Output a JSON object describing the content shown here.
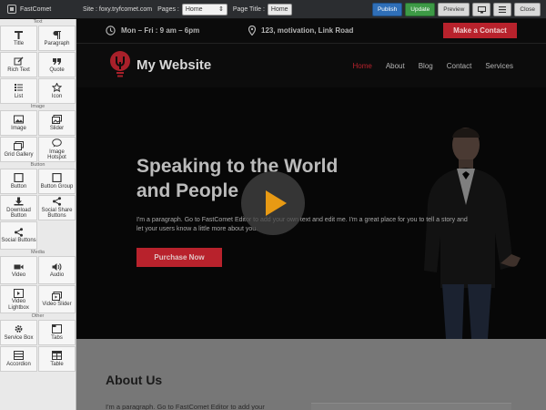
{
  "toolbar": {
    "brand": "FastComet",
    "site_label": "Site : foxy.tryfcomet.com",
    "pages_label": "Pages :",
    "pages_value": "Home",
    "page_title_label": "Page Title :",
    "page_title_value": "Home",
    "publish": "Publish",
    "update": "Update",
    "preview": "Preview",
    "close": "Close"
  },
  "sidebar": {
    "sections": {
      "text": "Text",
      "image": "Image",
      "button": "Button",
      "media": "Media",
      "other": "Other"
    },
    "widgets": {
      "title": "Title",
      "paragraph": "Paragraph",
      "rich_text": "Rich Text",
      "quote": "Quote",
      "list": "List",
      "icon": "Icon",
      "image": "Image",
      "slider": "Slider",
      "grid_gallery": "Grid Gallery",
      "image_hotspot": "Image Hotspot",
      "button": "Button",
      "button_group": "Button Group",
      "download_button": "Download Button",
      "social_share_buttons": "Social Share Buttons",
      "social_buttons": "Social Buttons",
      "video": "Video",
      "audio": "Audio",
      "video_lightbox": "Video Lightbox",
      "video_slider": "Video Slider",
      "service_box": "Service Box",
      "tabs": "Tabs",
      "accordion": "Accordion",
      "table": "Table"
    }
  },
  "site": {
    "hours": "Mon – Fri : 9 am – 6pm",
    "address": "123, motivation, Link Road",
    "contact_button": "Make a Contact",
    "brand_name": "My Website",
    "nav": [
      "Home",
      "About",
      "Blog",
      "Contact",
      "Services"
    ],
    "hero_title": "Speaking to the World and People",
    "hero_text": "I'm a paragraph. Go to FastComet Editor to add your own text and edit me. I'm a great place for you to tell a story and let your users know a little more about you.",
    "hero_button": "Purchase Now",
    "about_title": "About Us",
    "about_text": "I'm a paragraph. Go to FastComet Editor to add your"
  },
  "colors": {
    "accent": "#b8222c",
    "play": "#e89a14",
    "publish": "#2f6fb8",
    "update": "#3d9a46"
  }
}
